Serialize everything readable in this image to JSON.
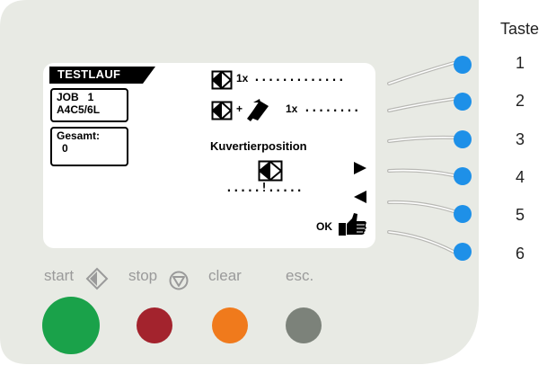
{
  "display": {
    "title": "TESTLAUF",
    "job_line1": "JOB   1",
    "job_line2": "A4C5/6L",
    "total_label": "Gesamt:",
    "total_value": "0",
    "row1_count": "1x",
    "row1_dots": ".............",
    "row2_count": "1x",
    "row2_dots": "........",
    "position_label": "Kuvertierposition",
    "position_scale": ".....!.....",
    "ok_label": "OK"
  },
  "keys": {
    "header": "Taste",
    "numbers": [
      "1",
      "2",
      "3",
      "4",
      "5",
      "6"
    ]
  },
  "buttons": {
    "start": "start",
    "stop": "stop",
    "clear": "clear",
    "esc": "esc."
  },
  "colors": {
    "panel": "#e8eae4",
    "panel_border": "#ffffff",
    "led": "#1e90e8",
    "start": "#1aa24a",
    "stop": "#a3232d",
    "clear": "#f07a1c",
    "esc": "#7c827a"
  },
  "icons": {
    "start": "diamond-arrow-icon",
    "stop": "circle-triangle-icon",
    "document": "document-diamond-icon",
    "insert": "insert-paper-icon",
    "arrow_right": "triangle-right-icon",
    "arrow_left": "triangle-left-icon",
    "ok": "thumbs-up-icon"
  }
}
